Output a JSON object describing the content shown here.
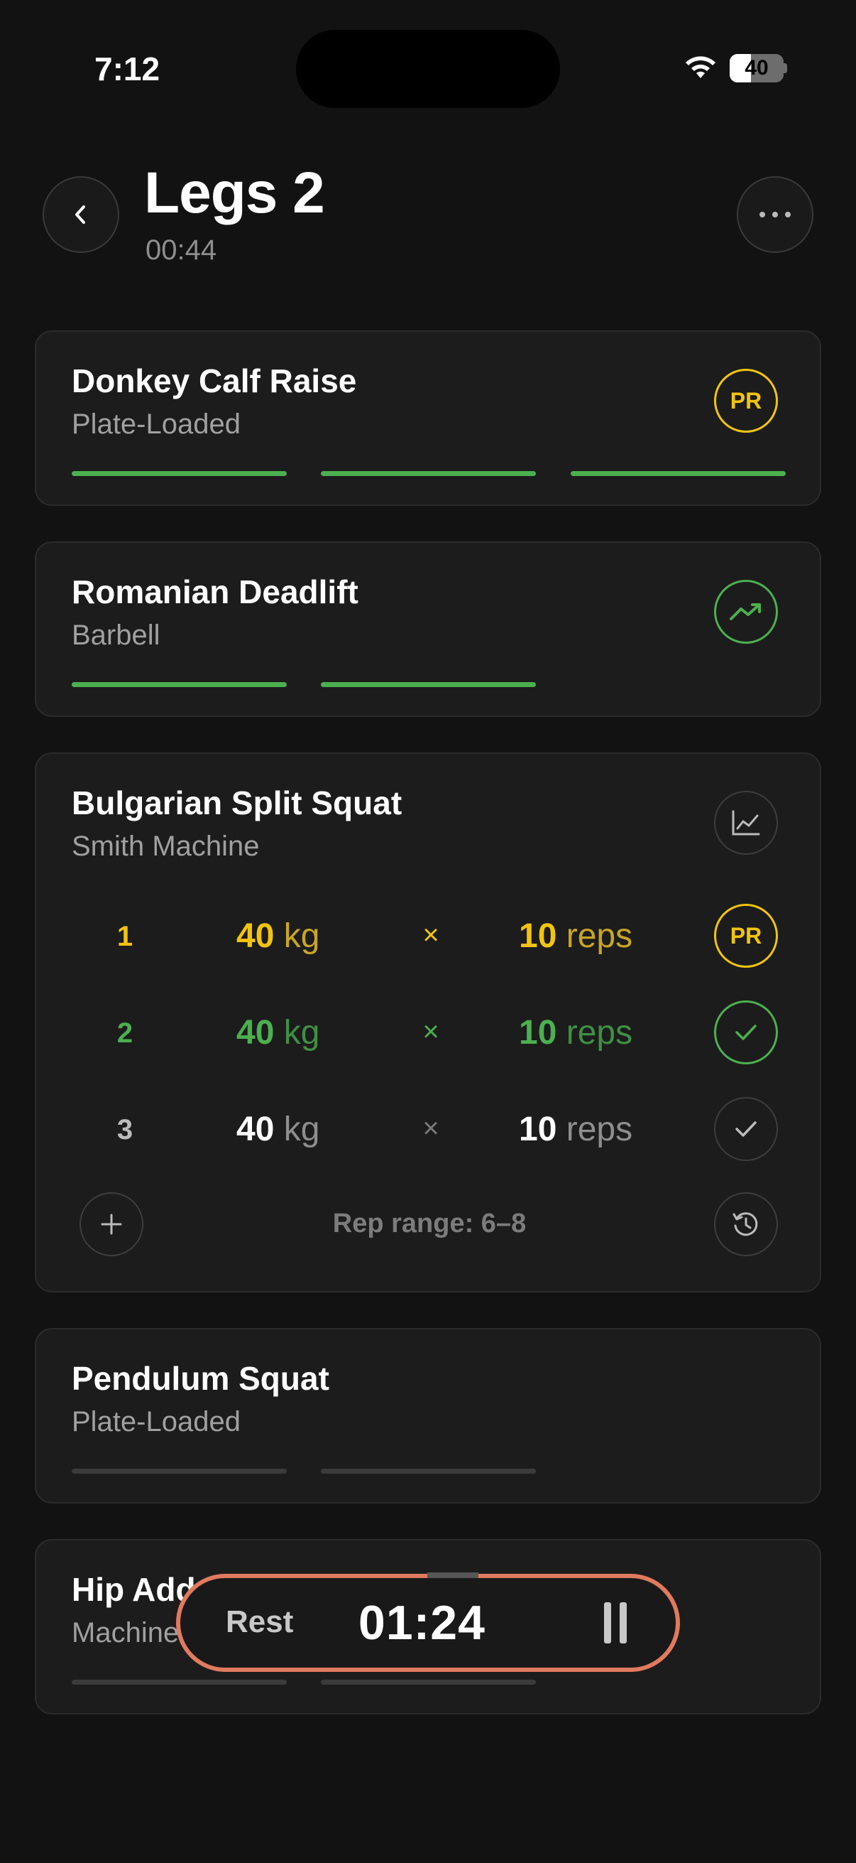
{
  "status_bar": {
    "time": "7:12",
    "battery": "40",
    "battery_level": 0.4
  },
  "header": {
    "title": "Legs 2",
    "elapsed": "00:44"
  },
  "exercises": [
    {
      "name": "Donkey Calf Raise",
      "equipment": "Plate-Loaded",
      "badge": "PR",
      "bars": [
        "green",
        "green",
        "green"
      ]
    },
    {
      "name": "Romanian Deadlift",
      "equipment": "Barbell",
      "badge_icon": "trend-up-icon",
      "bars": [
        "green",
        "green"
      ]
    },
    {
      "name": "Bulgarian Split Squat",
      "equipment": "Smith Machine",
      "badge_icon": "chart-icon",
      "sets": [
        {
          "num": "1",
          "weight": "40",
          "weight_unit": "kg",
          "x": "×",
          "reps": "10",
          "reps_unit": "reps",
          "status": "PR",
          "color": "yellow"
        },
        {
          "num": "2",
          "weight": "40",
          "weight_unit": "kg",
          "x": "×",
          "reps": "10",
          "reps_unit": "reps",
          "status": "done",
          "color": "green"
        },
        {
          "num": "3",
          "weight": "40",
          "weight_unit": "kg",
          "x": "×",
          "reps": "10",
          "reps_unit": "reps",
          "status": "pending",
          "color": "white"
        }
      ],
      "rep_range": "Rep range: 6–8"
    },
    {
      "name": "Pendulum Squat",
      "equipment": "Plate-Loaded",
      "bars": [
        "gray",
        "gray"
      ]
    },
    {
      "name": "Hip Add",
      "equipment": "Machine",
      "bars": [
        "gray",
        "gray"
      ]
    }
  ],
  "rest_timer": {
    "label": "Rest",
    "time": "01:24",
    "accent": "#e07a5f"
  },
  "colors": {
    "green": "#4caf50",
    "yellow": "#f2c40f",
    "background": "#121212"
  }
}
